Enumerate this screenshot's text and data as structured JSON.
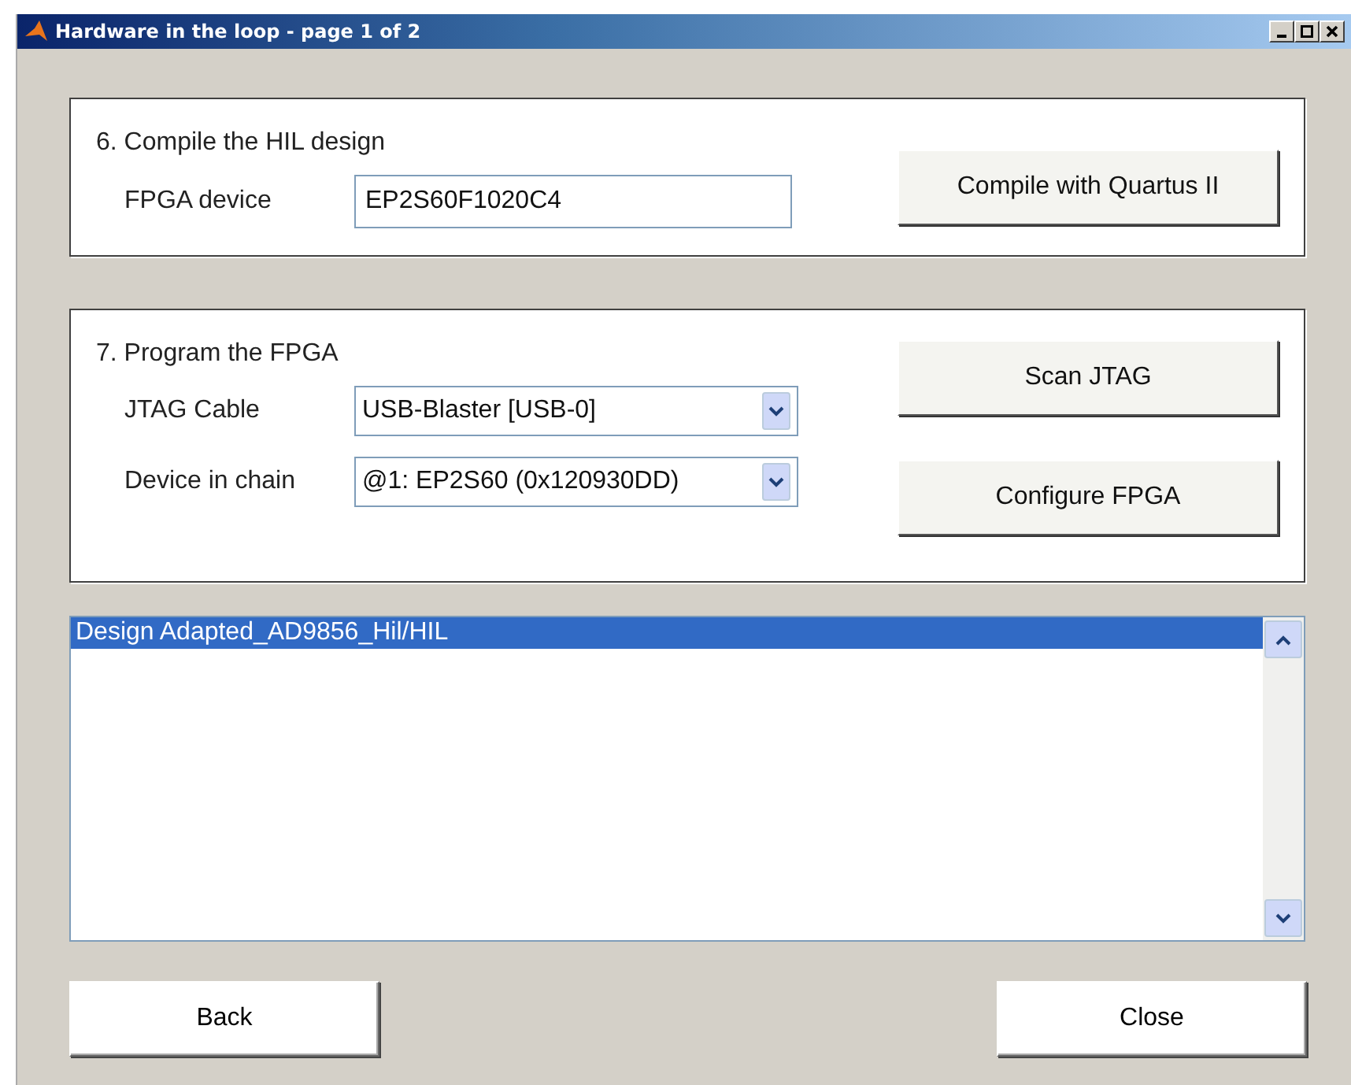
{
  "window": {
    "title": "Hardware in the loop - page 1 of 2"
  },
  "sections": [
    {
      "title": "6. Compile the HIL design",
      "fields": [
        {
          "kind": "text",
          "label": "FPGA device",
          "value": "EP2S60F1020C4"
        }
      ],
      "buttons": [
        "Compile with Quartus II"
      ]
    },
    {
      "title": "7. Program the FPGA",
      "fields": [
        {
          "kind": "dropdown",
          "label": "JTAG Cable",
          "value": "USB-Blaster [USB-0]"
        },
        {
          "kind": "dropdown",
          "label": "Device in chain",
          "value": "@1: EP2S60 (0x120930DD)"
        }
      ],
      "buttons": [
        "Scan JTAG",
        "Configure FPGA"
      ]
    }
  ],
  "log": {
    "items": [
      {
        "text": "Design Adapted_AD9856_Hil/HIL",
        "selected": true
      }
    ]
  },
  "buttons": [
    "Back",
    "Close"
  ]
}
